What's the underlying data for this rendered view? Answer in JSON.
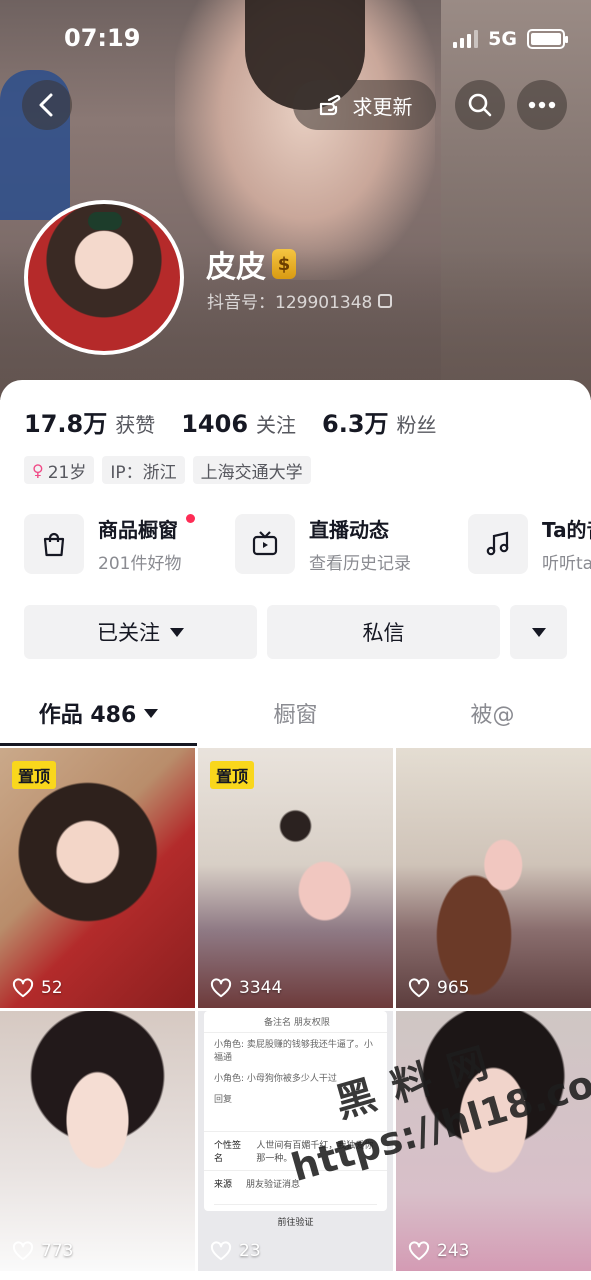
{
  "status_bar": {
    "time": "07:19",
    "network": "5G"
  },
  "header": {
    "update_button": "求更新"
  },
  "profile": {
    "name": "皮皮",
    "badge_glyph": "$",
    "douyin_id": "抖音号：129901348",
    "stats": [
      {
        "num": "17.8万",
        "label": "获赞"
      },
      {
        "num": "1406",
        "label": "关注"
      },
      {
        "num": "6.3万",
        "label": "粉丝"
      }
    ],
    "tags": {
      "age": "21岁",
      "ip": "IP：浙江",
      "school": "上海交通大学"
    }
  },
  "features": [
    {
      "title": "商品橱窗",
      "subtitle": "201件好物",
      "icon": "shopping-bag-icon",
      "has_dot": true
    },
    {
      "title": "直播动态",
      "subtitle": "查看历史记录",
      "icon": "tv-icon",
      "has_dot": false
    },
    {
      "title": "Ta的音乐",
      "subtitle": "听听ta的歌单",
      "icon": "music-note-icon",
      "has_dot": false
    }
  ],
  "actions": {
    "follow": "已关注",
    "message": "私信"
  },
  "tabs": {
    "works": "作品 486",
    "showcase": "橱窗",
    "mentioned": "被@"
  },
  "grid": [
    {
      "pinned": "置顶",
      "likes": "52"
    },
    {
      "pinned": "置顶",
      "likes": "3344"
    },
    {
      "pinned": "",
      "likes": "965"
    },
    {
      "pinned": "",
      "likes": "773"
    },
    {
      "pinned": "",
      "likes": "23"
    },
    {
      "pinned": "",
      "likes": "243"
    }
  ],
  "screenshot_tile": {
    "top_row": "备注名    朋友权限",
    "msg1": "小角色: 卖屁股赚的钱够我还牛逼了。小福通",
    "msg2": "小角色: 小母狗你被多少人干过",
    "reply": "回复",
    "signature_label": "个性签名",
    "signature_text": "人世间有百媚千红，我独爱你那一种。",
    "source_label": "来源",
    "source_text": "朋友验证消息",
    "verify": "前往验证"
  },
  "watermark": {
    "cn": "黑料网",
    "url": "https://hl18.co"
  },
  "colors": {
    "accent_red": "#fe2c55",
    "pin_yellow": "#f9d71c",
    "female_pink": "#f04b87"
  }
}
